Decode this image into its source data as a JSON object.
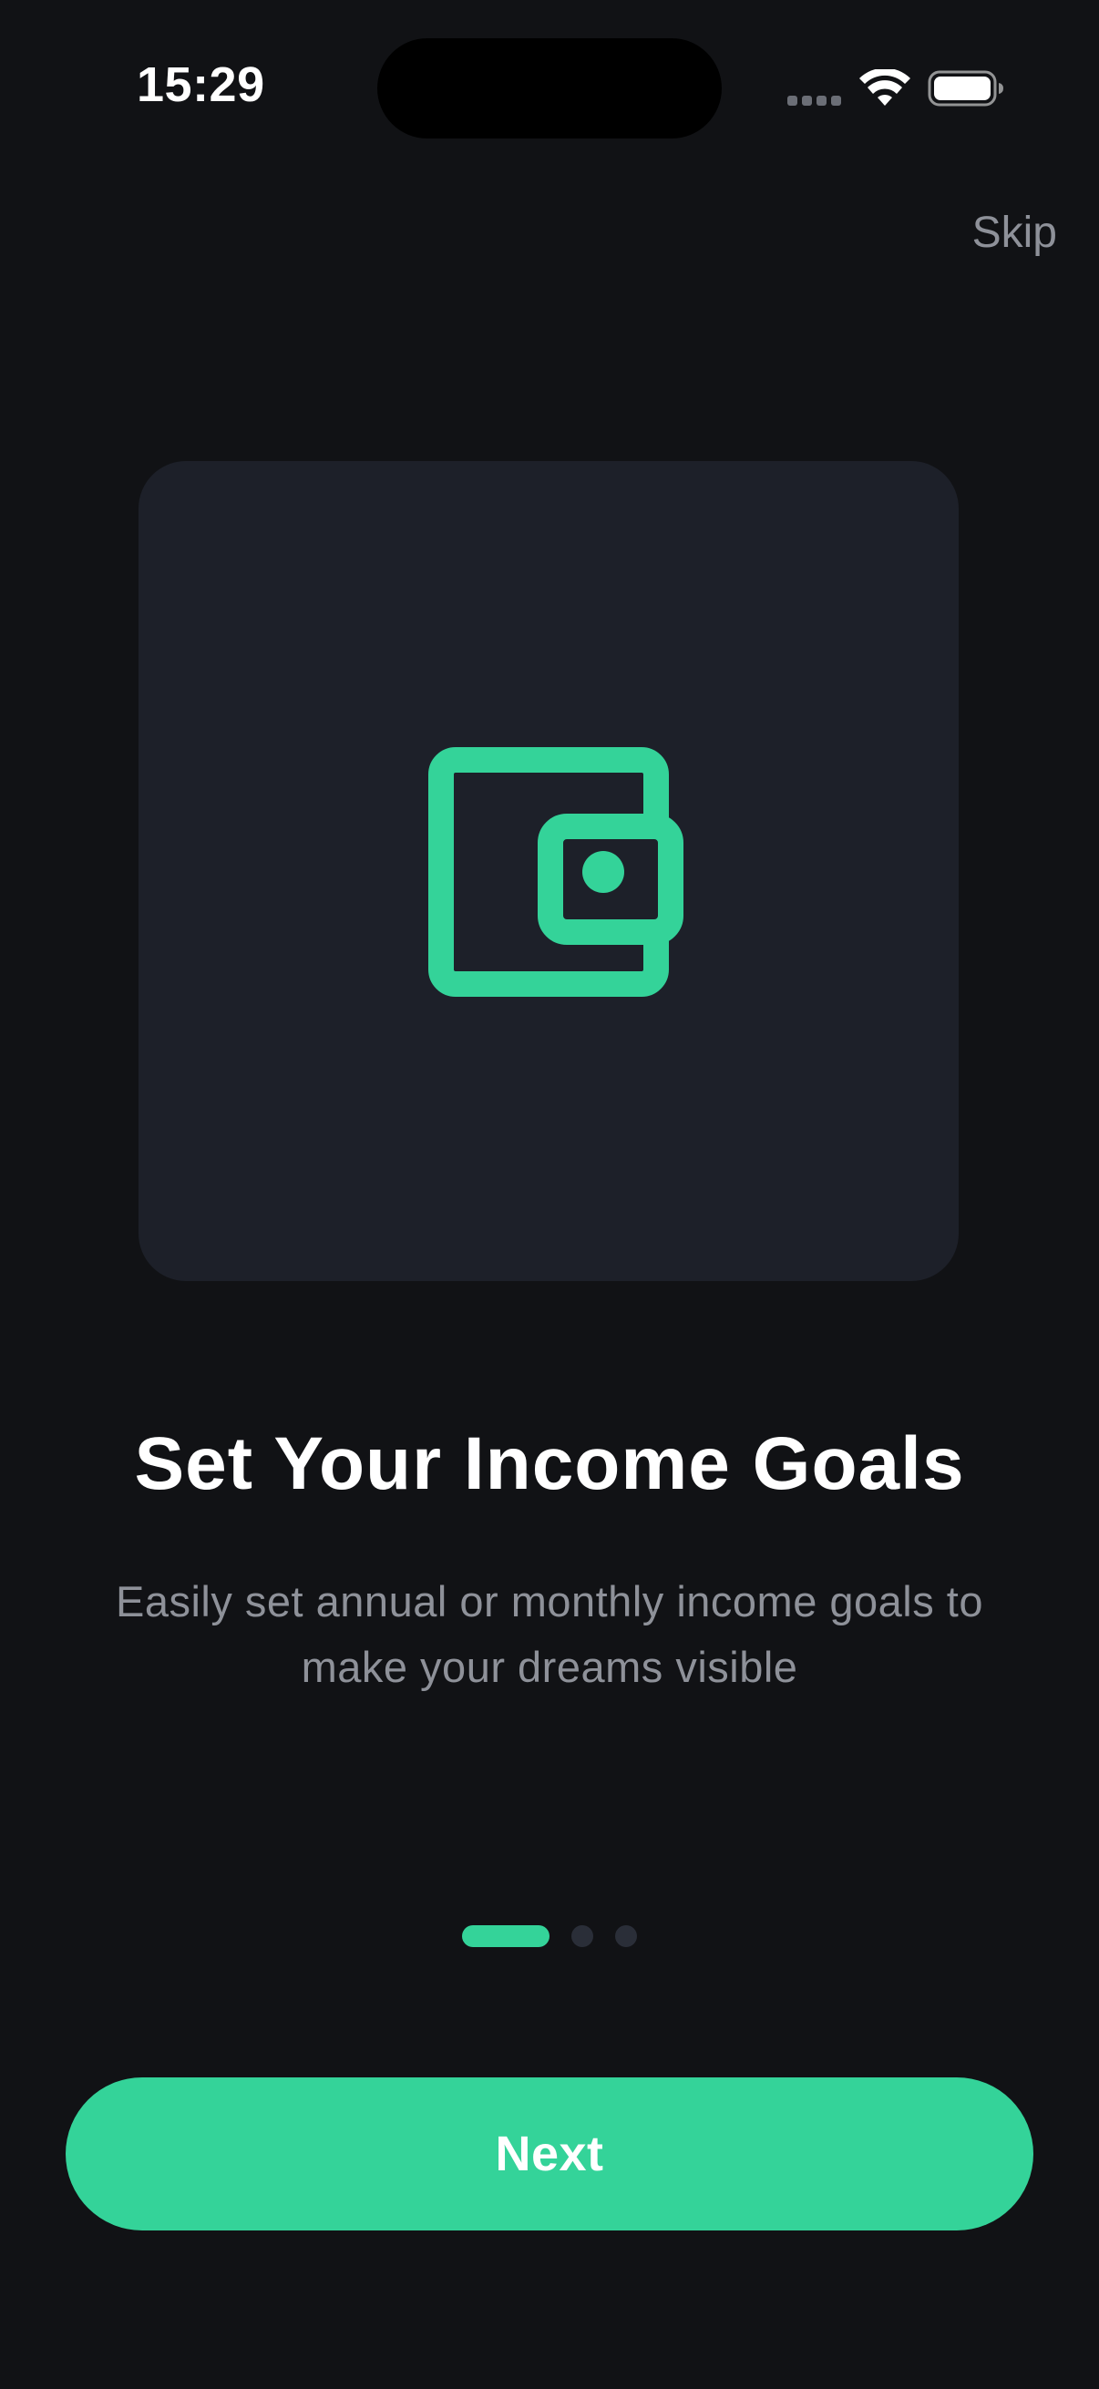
{
  "status_bar": {
    "time": "15:29",
    "signal_icon": "cellular-signal-icon",
    "wifi_icon": "wifi-icon",
    "battery_icon": "battery-icon"
  },
  "header": {
    "skip_label": "Skip"
  },
  "illustration": {
    "icon": "wallet-icon",
    "accent_color": "#34d399",
    "card_color": "#1d2029"
  },
  "content": {
    "title": "Set Your Income Goals",
    "subtitle": "Easily set annual or monthly income goals to make your dreams visible"
  },
  "pagination": {
    "total_pages": 3,
    "current_page": 1
  },
  "footer": {
    "next_label": "Next"
  },
  "colors": {
    "background": "#111215",
    "accent": "#34d399",
    "muted_text": "#8e9199",
    "inactive_dot": "#2a2e38"
  }
}
